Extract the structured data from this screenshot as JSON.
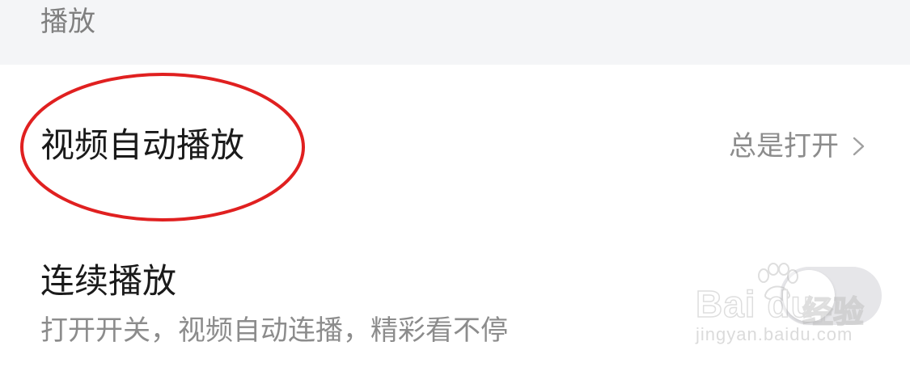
{
  "section": {
    "title": "播放"
  },
  "autoplay": {
    "label": "视频自动播放",
    "value": "总是打开"
  },
  "continuous": {
    "label": "连续播放",
    "description": "打开开关，视频自动连播，精彩看不停",
    "toggle_on": false
  },
  "watermark": {
    "brand": "Bai du",
    "brand_cn": "经验",
    "url": "jingyan.baidu.com"
  },
  "colors": {
    "highlight": "#e02020",
    "header_bg": "#f4f5f7",
    "toggle_off": "#e6e6e9"
  }
}
